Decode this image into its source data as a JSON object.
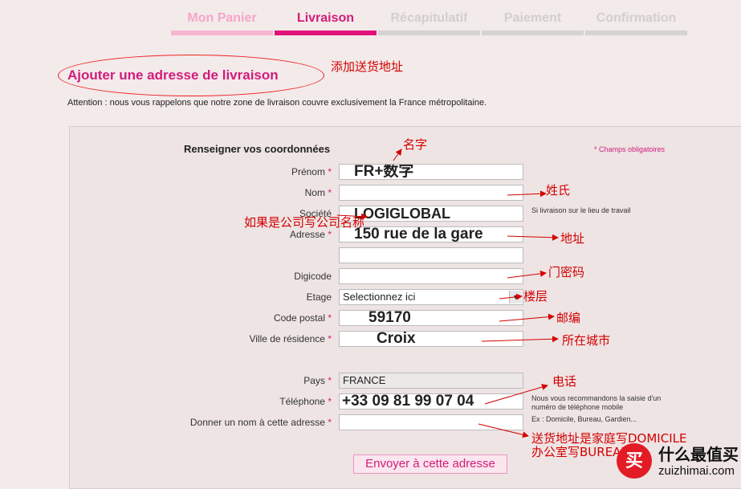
{
  "steps": [
    {
      "label": "Mon Panier",
      "state": "done"
    },
    {
      "label": "Livraison",
      "state": "active"
    },
    {
      "label": "Récapitulatif",
      "state": "todo"
    },
    {
      "label": "Paiement",
      "state": "todo"
    },
    {
      "label": "Confirmation",
      "state": "todo"
    }
  ],
  "page_title": "Ajouter une adresse de livraison",
  "attention": "Attention : nous vous rappelons que notre zone de livraison couvre exclusivement la France métropolitaine.",
  "form": {
    "heading": "Renseigner vos coordonnées",
    "required_note": "* Champs obligatoires",
    "prenom": {
      "label": "Prénom",
      "value": "FR+数字"
    },
    "nom": {
      "label": "Nom",
      "value": ""
    },
    "societe": {
      "label": "Société",
      "value": "LOGIGLOBAL",
      "hint": "Si livraison sur le lieu de travail"
    },
    "adresse": {
      "label": "Adresse",
      "value": "150 rue de la gare",
      "value2": ""
    },
    "digicode": {
      "label": "Digicode",
      "value": ""
    },
    "etage": {
      "label": "Etage",
      "value": "Selectionnez ici"
    },
    "code_postal": {
      "label": "Code postal",
      "value": "59170"
    },
    "ville": {
      "label": "Ville de résidence",
      "value": "Croix"
    },
    "pays": {
      "label": "Pays",
      "value": "FRANCE"
    },
    "telephone": {
      "label": "Téléphone",
      "value": "+33 09 81 99 07 04",
      "hint": "Nous vous recommandons la saisie d'un numéro de téléphone mobile"
    },
    "nom_adresse": {
      "label": "Donner un nom à cette adresse",
      "value": "",
      "hint": "Ex : Domicile, Bureau, Gardien..."
    },
    "star": "*",
    "submit": "Envoyer à cette adresse"
  },
  "annotations": {
    "add_address": "添加送货地址",
    "prenom": "名字",
    "nom": "姓氏",
    "societe": "如果是公司写公司名称",
    "adresse": "地址",
    "digicode": "门密码",
    "etage": "楼层",
    "code_postal": "邮编",
    "ville": "所在城市",
    "telephone": "电话",
    "nom_adresse_1": "送货地址是家庭写DOMICILE",
    "nom_adresse_2": "办公室写BUREAU"
  },
  "logo": {
    "mark": "买",
    "name_cn": "什么最值买",
    "name_en": "zuizhimai.com"
  },
  "colors": {
    "accent": "#d11c7b",
    "annotation": "#d40000"
  }
}
